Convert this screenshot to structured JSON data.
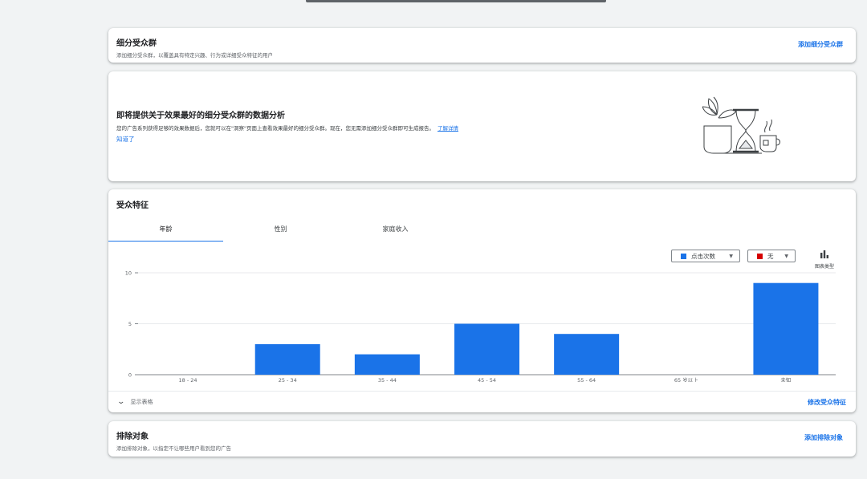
{
  "segments": {
    "title": "细分受众群",
    "subtitle": "添加细分受众群，以覆盖具有特定兴趣、行为或详细受众特征的用户",
    "add_label": "添加细分受众群"
  },
  "insights": {
    "title": "即将提供关于效果最好的细分受众群的数据分析",
    "description": "您的广告系列获得足够的效果数据后，您就可以在\"洞察\"页面上查看效果最好的细分受众群。现在，您无需添加细分受众群即可生成报告。",
    "learn_more": "了解详情",
    "got_it": "知道了",
    "illustration_icon": "hourglass-coffee-illustration"
  },
  "demographics": {
    "title": "受众特征",
    "tabs": [
      {
        "label": "年龄",
        "active": true
      },
      {
        "label": "性别",
        "active": false
      },
      {
        "label": "家庭收入",
        "active": false
      }
    ],
    "metric_select": {
      "label": "点击次数",
      "color": "#1a73e8"
    },
    "compare_select": {
      "label": "无",
      "color": "#d50000"
    },
    "chart_type_label": "图表类型",
    "show_table_label": "显示表格",
    "edit_label": "修改受众特征"
  },
  "exclusions": {
    "title": "排除对象",
    "subtitle": "添加排除对象，以指定不让哪些用户看到您的广告",
    "add_label": "添加排除对象"
  },
  "colors": {
    "accent": "#1a73e8",
    "bar": "#1a73e8",
    "compare": "#d50000"
  },
  "chart_data": {
    "type": "bar",
    "categories": [
      "18 - 24",
      "25 - 34",
      "35 - 44",
      "45 - 54",
      "55 - 64",
      "65 岁以上",
      "未知"
    ],
    "values": [
      0,
      3,
      2,
      5,
      4,
      0,
      9
    ],
    "ylim": [
      0,
      10
    ],
    "yticks": [
      0,
      5,
      10
    ],
    "grid": true
  }
}
